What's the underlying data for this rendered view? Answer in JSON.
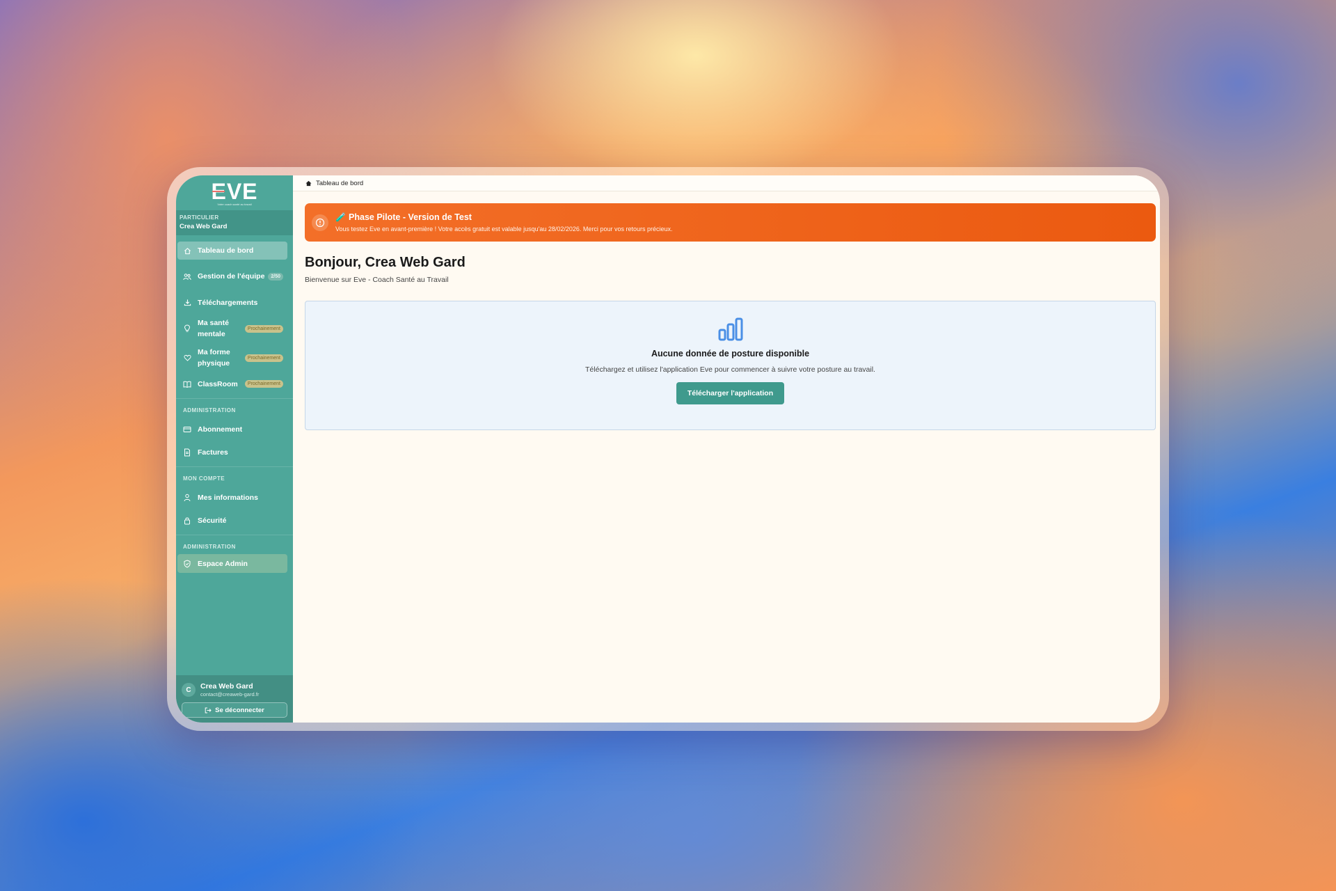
{
  "app": {
    "logo_text": "EVE",
    "logo_tagline": "Votre coach santé au travail"
  },
  "sidebar": {
    "account_type": "PARTICULIER",
    "account_name": "Crea Web Gard",
    "items": [
      {
        "label": "Tableau de bord",
        "icon": "home-icon",
        "active": true
      },
      {
        "label": "Gestion de l'équipe",
        "icon": "team-icon",
        "badge": "2/50"
      },
      {
        "label": "Téléchargements",
        "icon": "download-icon"
      },
      {
        "label": "Ma santé mentale",
        "icon": "lightbulb-icon",
        "badge": "Prochainement"
      },
      {
        "label": "Ma forme physique",
        "icon": "heart-icon",
        "badge": "Prochainement"
      },
      {
        "label": "ClassRoom",
        "icon": "book-icon",
        "badge": "Prochainement"
      }
    ],
    "section_admin": "ADMINISTRATION",
    "admin_items": [
      {
        "label": "Abonnement",
        "icon": "credit-card-icon"
      },
      {
        "label": "Factures",
        "icon": "document-icon"
      }
    ],
    "section_account": "MON COMPTE",
    "account_items": [
      {
        "label": "Mes informations",
        "icon": "user-icon"
      },
      {
        "label": "Sécurité",
        "icon": "lock-icon"
      }
    ],
    "section_admin2": "ADMINISTRATION",
    "admin_space": {
      "label": "Espace Admin",
      "icon": "shield-icon"
    },
    "user": {
      "initial": "C",
      "name": "Crea Web Gard",
      "email": "contact@creaweb-gard.fr"
    },
    "logout_label": "Se déconnecter"
  },
  "breadcrumb": {
    "label": "Tableau de bord"
  },
  "banner": {
    "title": "🧪 Phase Pilote - Version de Test",
    "text": "Vous testez Eve en avant-première ! Votre accès gratuit est valable jusqu'au 28/02/2026. Merci pour vos retours précieux."
  },
  "main": {
    "greeting": "Bonjour, Crea Web Gard",
    "subtitle": "Bienvenue sur Eve - Coach Santé au Travail",
    "empty_title": "Aucune donnée de posture disponible",
    "empty_text": "Téléchargez et utilisez l'application Eve pour commencer à suivre votre posture au travail.",
    "download_button": "Télécharger l'application"
  },
  "colors": {
    "sidebar": "#4ea79a",
    "accent": "#3f9a8d",
    "banner": "#ee6218",
    "card_bg": "#edf4fb"
  }
}
